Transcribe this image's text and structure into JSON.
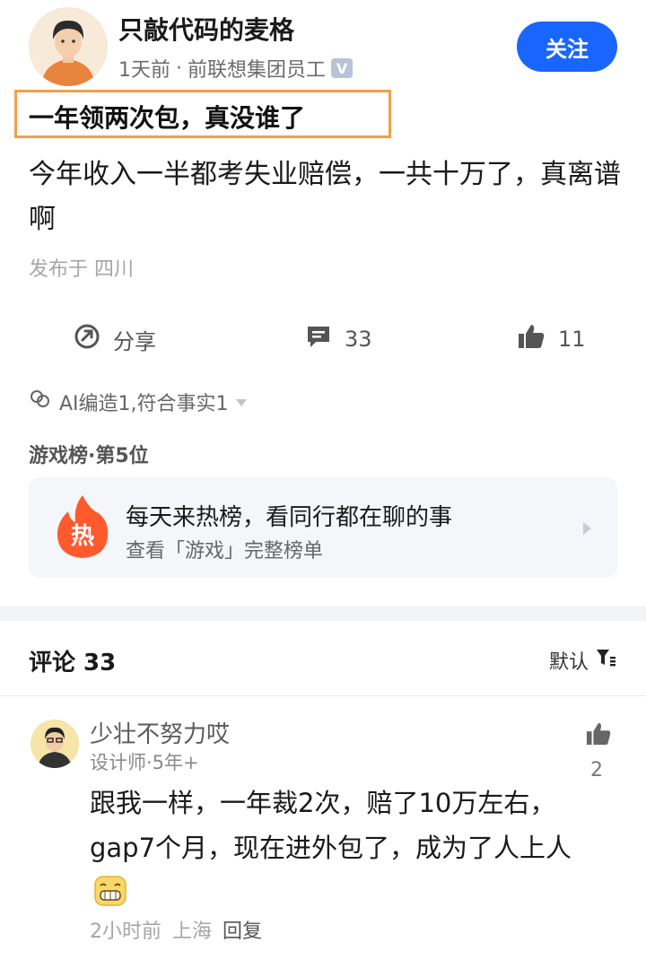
{
  "author": {
    "name": "只敲代码的麦格",
    "time": "1天前",
    "separator": "·",
    "identity": "前联想集团员工",
    "badge": "V"
  },
  "follow_label": "关注",
  "post": {
    "title": "一年领两次包，真没谁了",
    "body": "今年收入一半都考失业赔偿，一共十万了，真离谱啊",
    "location": "发布于 四川"
  },
  "actions": {
    "share_label": "分享",
    "comment_count": "33",
    "like_count": "11"
  },
  "ai_note": "AI编造1,符合事实1",
  "rank": "游戏榜·第5位",
  "hot_card": {
    "badge": "热",
    "title": "每天来热榜，看同行都在聊的事",
    "subtitle": "查看「游戏」完整榜单"
  },
  "comments_header": {
    "title": "评论 33",
    "sort_label": "默认"
  },
  "comment": {
    "name": "少壮不努力哎",
    "meta": "设计师·5年+",
    "likes": "2",
    "body": "跟我一样，一年裁2次，赔了10万左右，gap7个月，现在进外包了，成为了人上人",
    "time": "2小时前",
    "location": "上海",
    "reply_label": "回复"
  },
  "colors": {
    "accent": "#1966ff",
    "highlight_border": "#f0a04b",
    "hot": "#ff5a2e"
  }
}
